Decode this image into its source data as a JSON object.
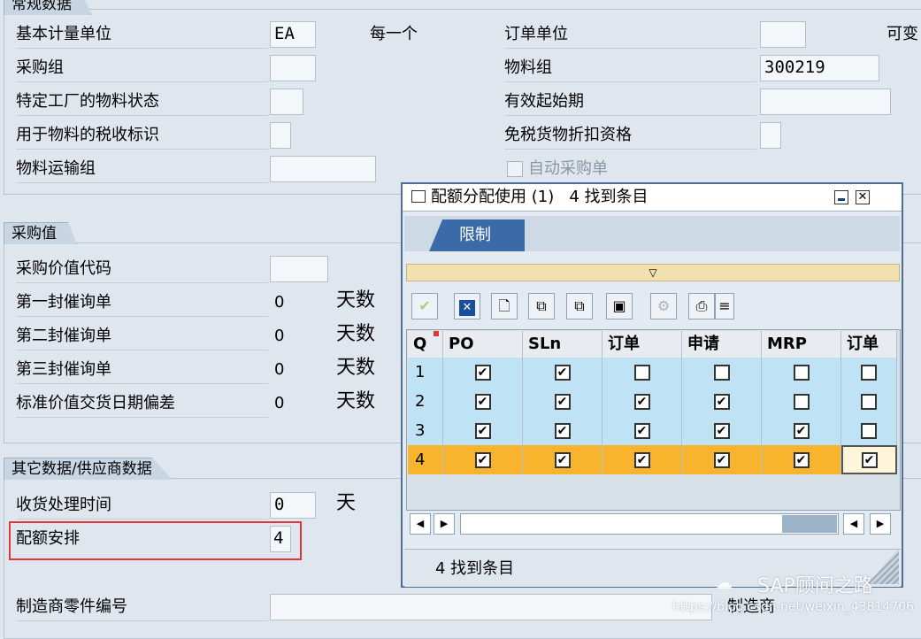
{
  "sections": {
    "general": {
      "title": "常规数据"
    },
    "purchasing": {
      "title": "采购值"
    },
    "other": {
      "title": "其它数据/供应商数据"
    }
  },
  "general": {
    "base_unit_label": "基本计量单位",
    "base_unit_value": "EA",
    "base_unit_text": "每一个",
    "purchasing_group_label": "采购组",
    "plant_status_label": "特定工厂的物料状态",
    "tax_label": "用于物料的税收标识",
    "shipping_group_label": "物料运输组",
    "order_unit_label": "订单单位",
    "variable_label": "可变",
    "material_group_label": "物料组",
    "material_group_value": "300219",
    "valid_from_label": "有效起始期",
    "discount_label": "免税货物折扣资格",
    "auto_po_label": "自动采购单"
  },
  "purchasing": {
    "value_key_label": "采购价值代码",
    "reminder1_label": "第一封催询单",
    "reminder1_value": "0",
    "reminder2_label": "第二封催询单",
    "reminder2_value": "0",
    "reminder3_label": "第三封催询单",
    "reminder3_value": "0",
    "deviation_label": "标准价值交货日期偏差",
    "deviation_value": "0",
    "days_unit": "天数"
  },
  "other": {
    "gr_time_label": "收货处理时间",
    "gr_time_value": "0",
    "gr_time_unit": "天",
    "quota_label": "配额安排",
    "quota_value": "4",
    "mpn_label": "制造商零件编号",
    "manufacturer_label": "制造商"
  },
  "dialog": {
    "title": "配额分配使用 (1)   4 找到条目",
    "tab": "限制",
    "footer": "4 找到条目",
    "columns": [
      "Q",
      "PO",
      "SLn",
      "订单",
      "申请",
      "MRP",
      "订单"
    ],
    "rows": [
      {
        "q": "1",
        "checks": [
          true,
          true,
          false,
          false,
          false,
          false
        ]
      },
      {
        "q": "2",
        "checks": [
          true,
          true,
          true,
          true,
          false,
          false
        ]
      },
      {
        "q": "3",
        "checks": [
          true,
          true,
          true,
          true,
          true,
          false
        ]
      },
      {
        "q": "4",
        "checks": [
          true,
          true,
          true,
          true,
          true,
          true
        ]
      }
    ]
  },
  "watermark": {
    "brand": "SAP顾问之路",
    "url": "https://blog.csdn.net/weixin_43814706"
  },
  "colors": {
    "row_normal": "#bfe3f5",
    "row_selected": "#f7b42c",
    "highlight_border": "#e0353a"
  }
}
